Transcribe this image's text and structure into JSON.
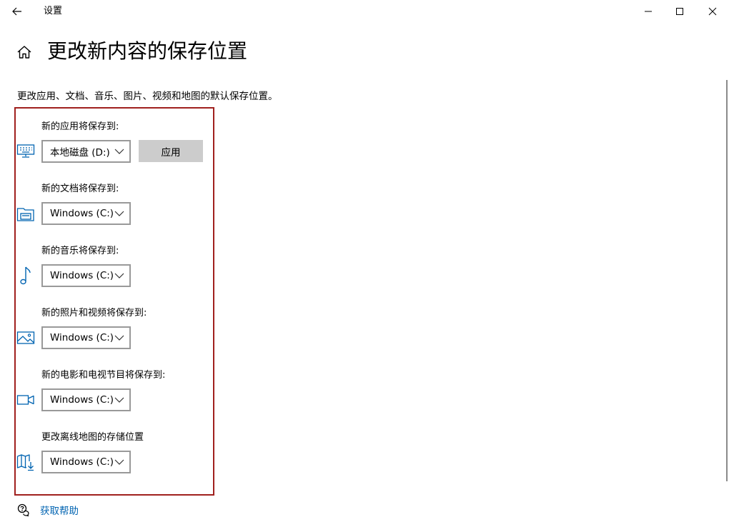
{
  "window": {
    "app_title": "设置",
    "back_icon": "arrow-left-icon",
    "minimize_icon": "minimize-icon",
    "maximize_icon": "maximize-icon",
    "close_icon": "close-icon"
  },
  "header": {
    "home_icon": "home-icon",
    "title": "更改新内容的保存位置"
  },
  "description": "更改应用、文档、音乐、图片、视频和地图的默认保存位置。",
  "accent_color": "#0063b1",
  "highlight_color": "#a0201e",
  "sections": [
    {
      "label": "新的应用将保存到:",
      "icon": "keyboard-monitor-icon",
      "selected_drive": "本地磁盘 (D:)",
      "apply_label": "应用"
    },
    {
      "label": "新的文档将保存到:",
      "icon": "document-folder-icon",
      "selected_drive": "Windows (C:)"
    },
    {
      "label": "新的音乐将保存到:",
      "icon": "music-note-icon",
      "selected_drive": "Windows (C:)"
    },
    {
      "label": "新的照片和视频将保存到:",
      "icon": "picture-icon",
      "selected_drive": "Windows (C:)"
    },
    {
      "label": "新的电影和电视节目将保存到:",
      "icon": "video-camera-icon",
      "selected_drive": "Windows (C:)"
    },
    {
      "label": "更改离线地图的存储位置",
      "icon": "map-download-icon",
      "selected_drive": "Windows (C:)"
    }
  ],
  "help": {
    "icon": "help-chat-icon",
    "label": "获取帮助"
  }
}
